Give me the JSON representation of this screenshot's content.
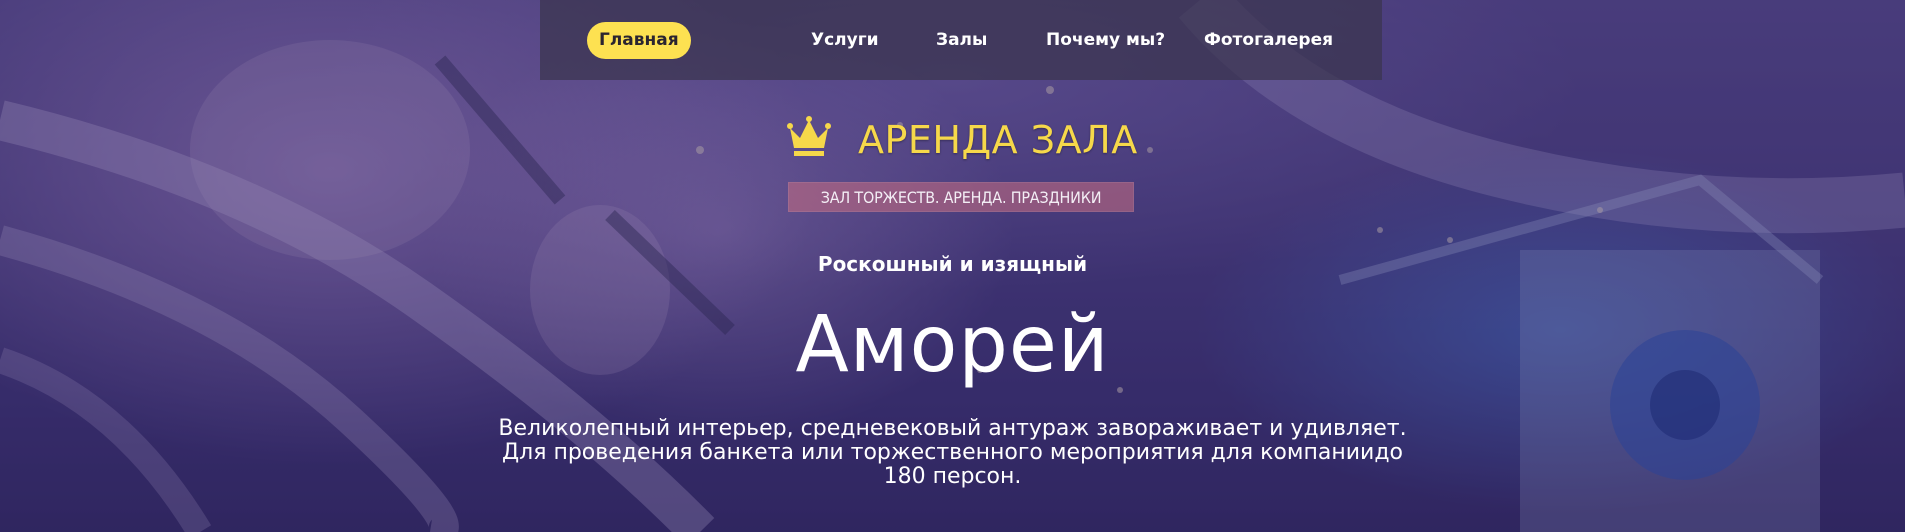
{
  "nav": {
    "items": [
      {
        "label": "Главная",
        "active": true
      },
      {
        "label": "Услуги"
      },
      {
        "label": "Залы"
      },
      {
        "label": "Почему мы?"
      },
      {
        "label": "Фотогалерея"
      }
    ]
  },
  "logo": {
    "icon": "crown-icon",
    "title": "АРЕНДА ЗАЛА",
    "tagline": "ЗАЛ ТОРЖЕСТВ. АРЕНДА. ПРАЗДНИКИ"
  },
  "hero": {
    "subtitle": "Роскошный и изящный",
    "title": "Аморей",
    "description": "Великолепный интерьер, средневековый антураж завораживает и удивляет. Для проведения банкета или торжественного мероприятия для компаниидо 180 персон."
  },
  "colors": {
    "accent": "#fde151",
    "logo_gold": "#f6d84a",
    "overlay": "#302462"
  }
}
